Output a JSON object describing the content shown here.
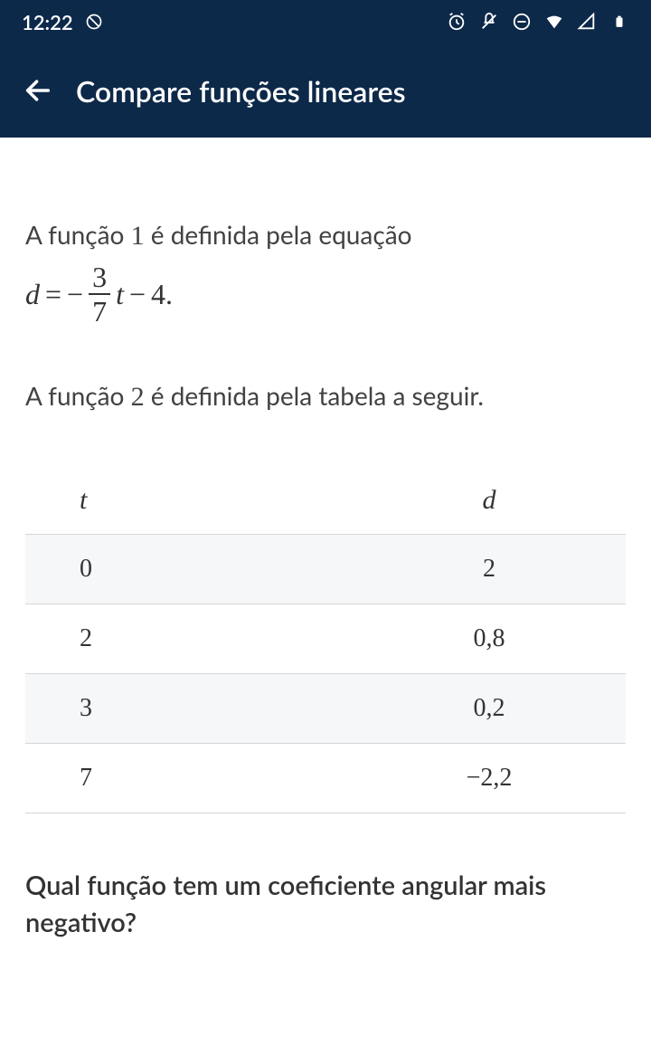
{
  "status": {
    "time": "12:22"
  },
  "header": {
    "title": "Compare funções lineares"
  },
  "problem": {
    "intro1_prefix": "A função ",
    "intro1_num": "1",
    "intro1_suffix": " é definida pela equação",
    "equation": {
      "lhs": "d",
      "frac_num": "3",
      "frac_den": "7",
      "var": "t",
      "constant": "4."
    },
    "intro2_prefix": "A função ",
    "intro2_num": "2",
    "intro2_suffix": " é definida pela tabela a seguir.",
    "table": {
      "headers": {
        "col1": "t",
        "col2": "d"
      },
      "rows": [
        {
          "t": "0",
          "d": "2"
        },
        {
          "t": "2",
          "d": "0,8"
        },
        {
          "t": "3",
          "d": "0,2"
        },
        {
          "t": "7",
          "d": "−2,2"
        }
      ]
    },
    "question": "Qual função tem um coeficiente angular mais negativo?"
  }
}
